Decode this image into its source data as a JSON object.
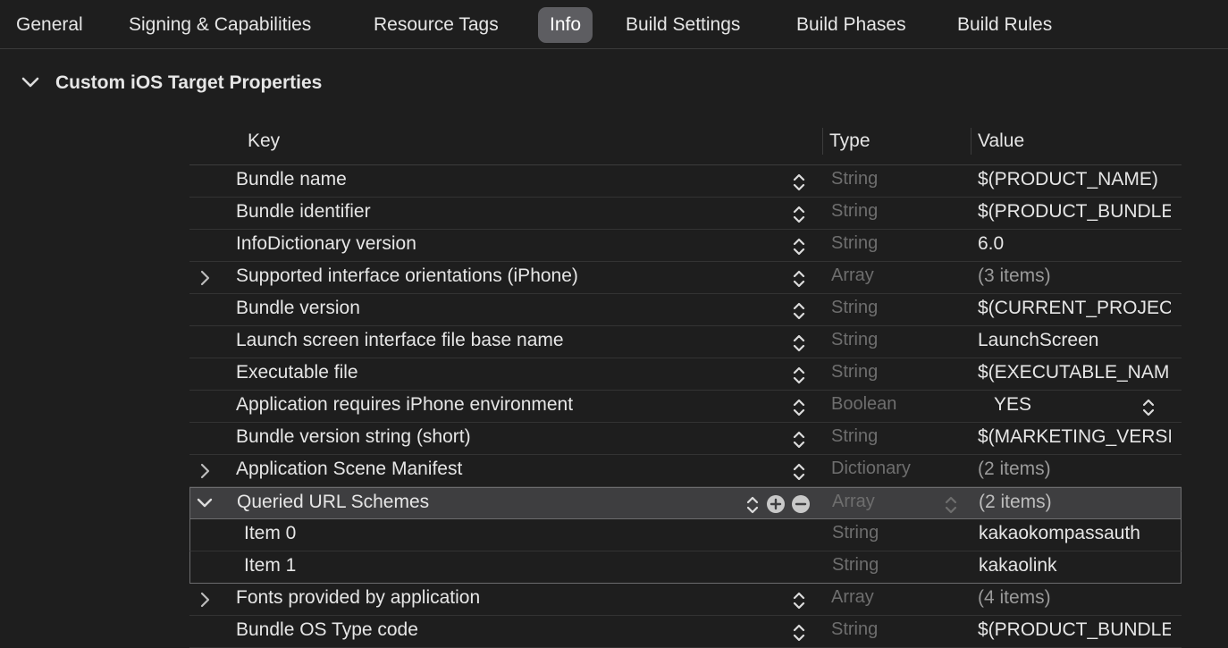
{
  "tabs": [
    {
      "label": "General"
    },
    {
      "label": "Signing & Capabilities"
    },
    {
      "label": "Resource Tags"
    },
    {
      "label": "Info"
    },
    {
      "label": "Build Settings"
    },
    {
      "label": "Build Phases"
    },
    {
      "label": "Build Rules"
    }
  ],
  "active_tab": "Info",
  "section": {
    "title": "Custom iOS Target Properties"
  },
  "table": {
    "headers": {
      "key": "Key",
      "type": "Type",
      "value": "Value"
    },
    "rows": [
      {
        "key": "Bundle name",
        "type": "String",
        "value": "$(PRODUCT_NAME)"
      },
      {
        "key": "Bundle identifier",
        "type": "String",
        "value": "$(PRODUCT_BUNDLE_IDENTIFIER)"
      },
      {
        "key": "InfoDictionary version",
        "type": "String",
        "value": "6.0"
      },
      {
        "key": "Supported interface orientations (iPhone)",
        "type": "Array",
        "value": "(3 items)"
      },
      {
        "key": "Bundle version",
        "type": "String",
        "value": "$(CURRENT_PROJECT_VERSION)"
      },
      {
        "key": "Launch screen interface file base name",
        "type": "String",
        "value": "LaunchScreen"
      },
      {
        "key": "Executable file",
        "type": "String",
        "value": "$(EXECUTABLE_NAME)"
      },
      {
        "key": "Application requires iPhone environment",
        "type": "Boolean",
        "value": "YES"
      },
      {
        "key": "Bundle version string (short)",
        "type": "String",
        "value": "$(MARKETING_VERSION)"
      },
      {
        "key": "Application Scene Manifest",
        "type": "Dictionary",
        "value": "(2 items)"
      },
      {
        "key": "Queried URL Schemes",
        "type": "Array",
        "value": "(2 items)"
      },
      {
        "key": "Item 0",
        "type": "String",
        "value": "kakaokompassauth"
      },
      {
        "key": "Item 1",
        "type": "String",
        "value": "kakaolink"
      },
      {
        "key": "Fonts provided by application",
        "type": "Array",
        "value": "(4 items)"
      },
      {
        "key": "Bundle OS Type code",
        "type": "String",
        "value": "$(PRODUCT_BUNDLE_PACKAGE_TYPE)"
      }
    ]
  },
  "icons": {
    "section_toggle": "chevron-down-icon",
    "row_collapsed": "chevron-right-icon",
    "row_expanded": "chevron-down-icon",
    "stepper": "up-down-stepper-icon",
    "add": "plus-circle-icon",
    "remove": "minus-circle-icon"
  },
  "colors": {
    "background": "#1e1e1e",
    "active_tab": "#5d5d61",
    "selected_row": "#3e3e40",
    "muted_text": "#6e6e6e"
  }
}
